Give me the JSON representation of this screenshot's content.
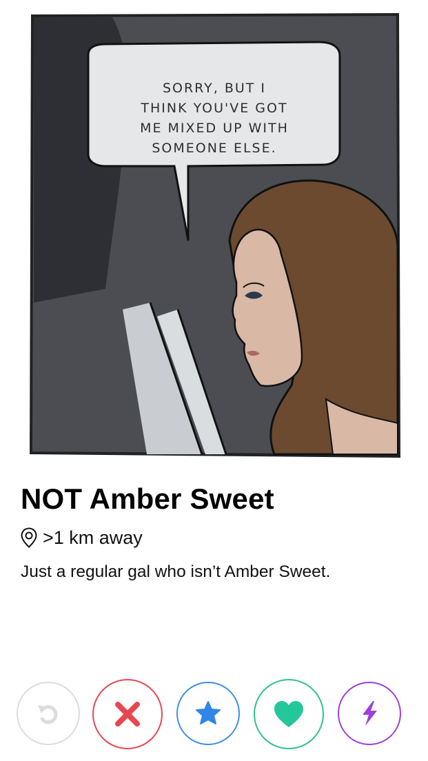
{
  "photo": {
    "alt": "Comic panel profile photo",
    "speech_bubble": [
      "SORRY, BUT I",
      "THINK YOU'VE GOT",
      "ME MIXED UP WITH",
      "SOMEONE ELSE."
    ]
  },
  "profile": {
    "name": "NOT Amber Sweet",
    "distance": ">1 km away",
    "bio": "Just a regular gal who isn’t Amber Sweet."
  },
  "actions": [
    {
      "id": "rewind",
      "icon": "rewind-icon",
      "color": "#dcdcdc"
    },
    {
      "id": "nope",
      "icon": "close-icon",
      "color": "#e8474f"
    },
    {
      "id": "super-like",
      "icon": "star-icon",
      "color": "#3d8ee6"
    },
    {
      "id": "like",
      "icon": "heart-icon",
      "color": "#2ec28f"
    },
    {
      "id": "boost",
      "icon": "lightning-icon",
      "color": "#9b3fe0"
    }
  ]
}
